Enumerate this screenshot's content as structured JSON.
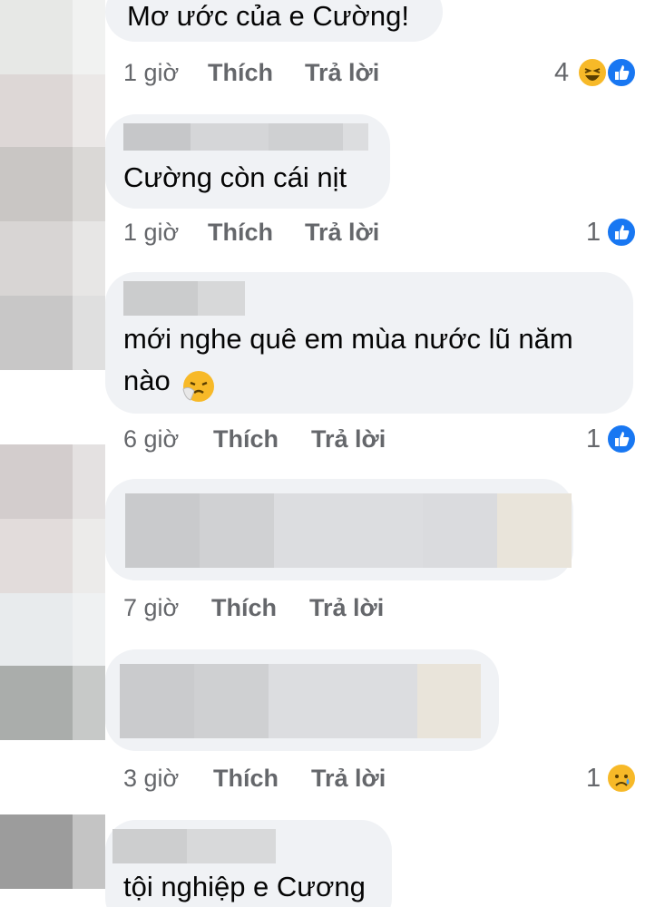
{
  "comments": [
    {
      "text": "Mơ ước của e Cường!",
      "time": "1 giờ",
      "like": "Thích",
      "reply": "Trả lời",
      "reaction_count": "4",
      "reaction_icons": [
        "haha-icon",
        "like-icon"
      ]
    },
    {
      "text": "Cường còn cái nịt",
      "time": "1 giờ",
      "like": "Thích",
      "reply": "Trả lời",
      "reaction_count": "1",
      "reaction_icons": [
        "like-icon"
      ]
    },
    {
      "text_line1": "mới nghe quê em mùa nước lũ năm",
      "text_line2": "nào",
      "emoji": "sneezing-face-icon",
      "time": "6 giờ",
      "like": "Thích",
      "reply": "Trả lời",
      "reaction_count": "1",
      "reaction_icons": [
        "like-icon"
      ]
    },
    {
      "time": "7 giờ",
      "like": "Thích",
      "reply": "Trả lời"
    },
    {
      "time": "3 giờ",
      "like": "Thích",
      "reply": "Trả lời",
      "reaction_count": "1",
      "reaction_icons": [
        "sad-icon"
      ]
    },
    {
      "text": "tội nghiệp e Cương"
    }
  ],
  "colors": {
    "bubble": "#f0f2f5",
    "meta_text": "#65676b",
    "like_blue": "#1877f2",
    "emoji_yellow": "#f7b928"
  }
}
